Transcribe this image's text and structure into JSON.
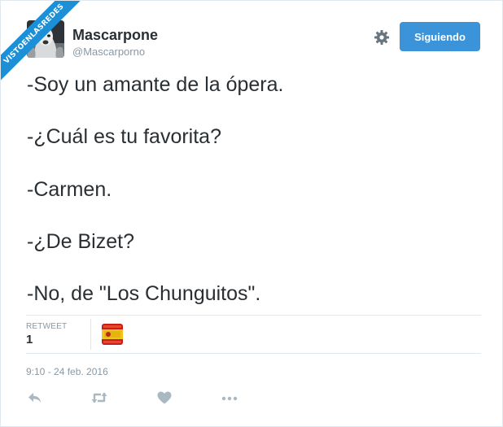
{
  "watermark": {
    "text": "VISTOENLASREDES"
  },
  "tweet": {
    "author_name": "Mascarpone",
    "author_handle": "@Mascarporno",
    "follow_label": "Siguiendo",
    "lines": [
      "-Soy un amante de la ópera.",
      "-¿Cuál es tu favorita?",
      "-Carmen.",
      "-¿De Bizet?",
      "-No, de \"Los Chunguitos\"."
    ],
    "stats": {
      "retweet_label": "RETWEET",
      "retweet_count": "1"
    },
    "timestamp": "9:10 - 24 feb. 2016"
  },
  "icons": {
    "settings": "gear-icon",
    "reply": "reply-icon",
    "retweet": "retweet-icon",
    "like": "heart-icon",
    "more": "more-dots-icon"
  },
  "colors": {
    "accent": "#3b94d9",
    "ribbon": "#1d8fd6",
    "text": "#292f33",
    "muted": "#8899a6",
    "icon": "#aab8c2",
    "border": "#e1e8ed"
  }
}
